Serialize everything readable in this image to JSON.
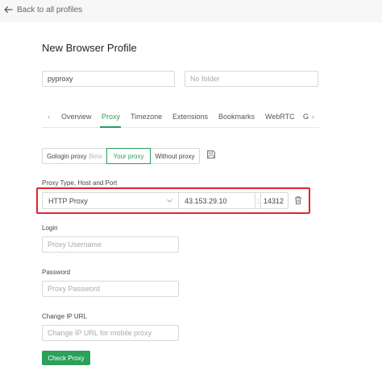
{
  "header": {
    "back_label": "Back to all profiles"
  },
  "page": {
    "title": "New Browser Profile"
  },
  "profile": {
    "name_value": "pyproxy",
    "folder_placeholder": "No folder"
  },
  "tabs": [
    {
      "label": "Overview",
      "active": false
    },
    {
      "label": "Proxy",
      "active": true
    },
    {
      "label": "Timezone",
      "active": false
    },
    {
      "label": "Extensions",
      "active": false
    },
    {
      "label": "Bookmarks",
      "active": false
    },
    {
      "label": "WebRTC",
      "active": false
    },
    {
      "label": "G",
      "active": false
    }
  ],
  "tab_arrows": {
    "left": "‹",
    "right": "›"
  },
  "proxy_mode": {
    "options": [
      {
        "label": "Gologin proxy",
        "badge": "Beta",
        "active": false
      },
      {
        "label": "Your proxy",
        "active": true
      },
      {
        "label": "Without proxy",
        "active": false
      }
    ]
  },
  "proxy": {
    "section_label": "Proxy Type, Host and Port",
    "type": "HTTP Proxy",
    "host": "43.153.29.10",
    "separator": ":",
    "port": "14312"
  },
  "login": {
    "label": "Login",
    "placeholder": "Proxy Username"
  },
  "password": {
    "label": "Password",
    "placeholder": "Proxy Password"
  },
  "change_ip": {
    "label": "Change IP URL",
    "placeholder": "Change IP URL for mobile proxy"
  },
  "actions": {
    "check_proxy_label": "Check Proxy"
  },
  "colors": {
    "accent": "#2aa05a",
    "highlight": "#e0262f"
  }
}
